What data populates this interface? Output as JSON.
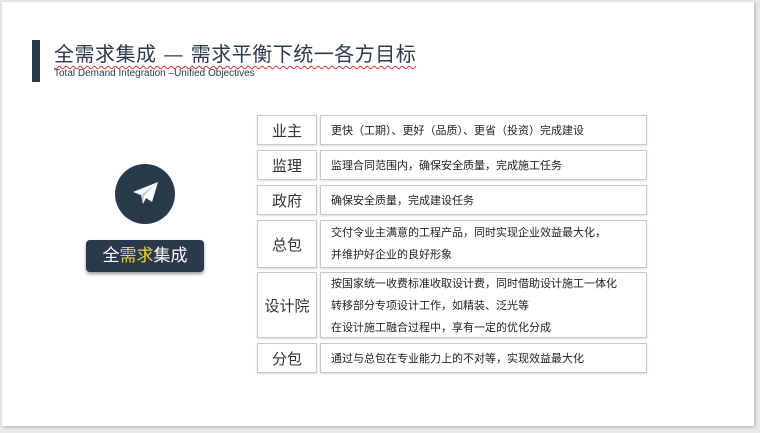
{
  "slide": {
    "title": "全需求集成 — 需求平衡下统一各方目标",
    "subtitle": "Total Demand Integration –Unified Objectives",
    "badge": {
      "part1": "全",
      "highlight": "需求",
      "part2": "集成"
    },
    "icon": "paper-plane-icon",
    "colors": {
      "primary": "#2a3a4b",
      "highlight": "#f4d23a",
      "underline": "#e03030"
    }
  },
  "table": {
    "rows": [
      {
        "label": "业主",
        "lines": [
          "更快（工期）、更好（品质）、更省（投资）完成建设"
        ]
      },
      {
        "label": "监理",
        "lines": [
          "监理合同范围内，确保安全质量，完成施工任务"
        ]
      },
      {
        "label": "政府",
        "lines": [
          "确保安全质量，完成建设任务"
        ]
      },
      {
        "label": "总包",
        "lines": [
          "交付令业主满意的工程产品，同时实现企业效益最大化，",
          "并维护好企业的良好形象"
        ]
      },
      {
        "label": "设计院",
        "lines": [
          "按国家统一收费标准收取设计费，同时借助设计施工一体化",
          "转移部分专项设计工作，如精装、泛光等",
          "在设计施工融合过程中，享有一定的优化分成"
        ]
      },
      {
        "label": "分包",
        "lines": [
          "通过与总包在专业能力上的不对等，实现效益最大化"
        ]
      }
    ]
  }
}
